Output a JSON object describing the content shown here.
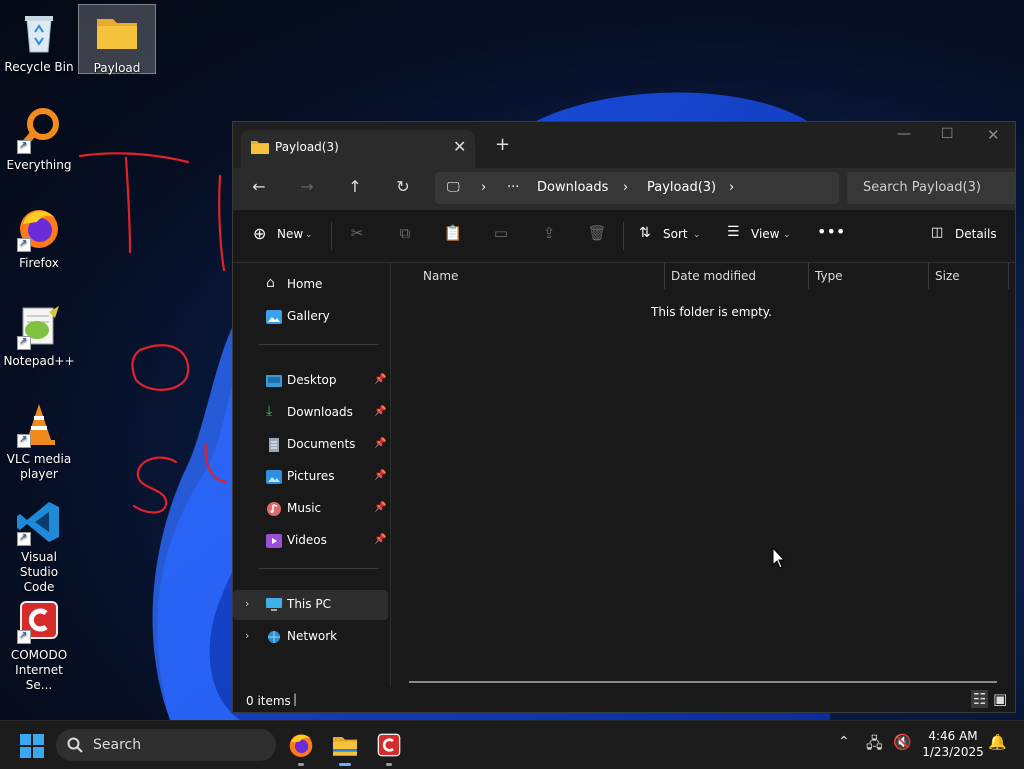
{
  "desktop": {
    "icons": [
      {
        "label": "Recycle Bin",
        "icon": "recycle-bin-icon"
      },
      {
        "label": "Payload",
        "icon": "folder-icon"
      },
      {
        "label": "Everything",
        "icon": "everything-search-icon"
      },
      {
        "label": "Firefox",
        "icon": "firefox-icon"
      },
      {
        "label": "Notepad++",
        "icon": "notepad-plus-plus-icon"
      },
      {
        "label": "VLC media player",
        "icon": "vlc-cone-icon"
      },
      {
        "label": "Visual Studio Code",
        "icon": "vscode-icon"
      },
      {
        "label": "COMODO Internet Se...",
        "icon": "comodo-icon"
      }
    ]
  },
  "window": {
    "tab_title": "Payload(3)",
    "breadcrumb": [
      "Downloads",
      "Payload(3)"
    ],
    "search_placeholder": "Search Payload(3)",
    "toolbar": {
      "new_label": "New",
      "sort_label": "Sort",
      "view_label": "View",
      "details_label": "Details"
    },
    "sidebar": {
      "quick": [
        {
          "label": "Home",
          "icon": "home-icon"
        },
        {
          "label": "Gallery",
          "icon": "gallery-icon"
        }
      ],
      "pinned": [
        {
          "label": "Desktop",
          "icon": "desktop-folder-icon"
        },
        {
          "label": "Downloads",
          "icon": "downloads-icon"
        },
        {
          "label": "Documents",
          "icon": "documents-icon"
        },
        {
          "label": "Pictures",
          "icon": "pictures-icon"
        },
        {
          "label": "Music",
          "icon": "music-icon"
        },
        {
          "label": "Videos",
          "icon": "videos-icon"
        }
      ],
      "locations": [
        {
          "label": "This PC",
          "icon": "this-pc-icon"
        },
        {
          "label": "Network",
          "icon": "network-icon"
        }
      ]
    },
    "columns": [
      "Name",
      "Date modified",
      "Type",
      "Size"
    ],
    "empty_message": "This folder is empty.",
    "status_items": "0 items"
  },
  "taskbar": {
    "search_label": "Search",
    "time": "4:46 AM",
    "date": "1/23/2025"
  },
  "colors": {
    "accent": "#0a67d8",
    "comodo_red": "#d62b2b",
    "folder_yellow": "#f5c33b"
  }
}
